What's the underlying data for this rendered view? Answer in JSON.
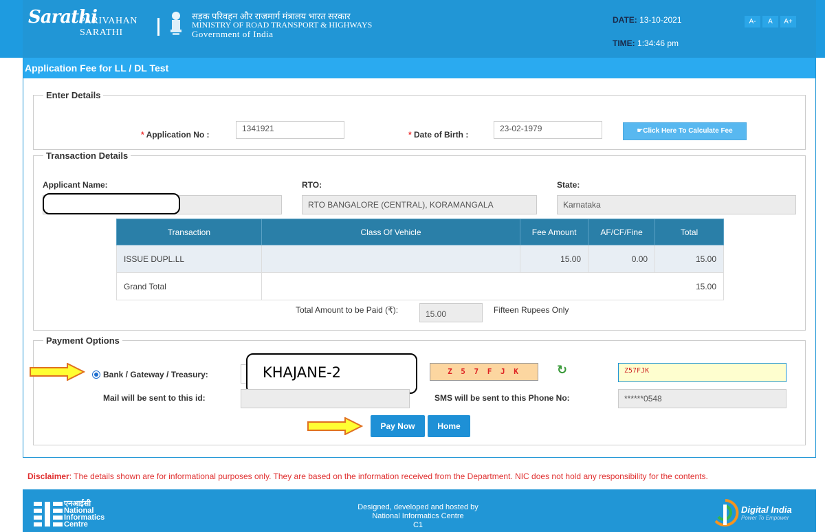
{
  "header": {
    "logo_sarathi": "Sarathi",
    "logo_parivahan": "PARIVAHAN",
    "logo_sarathi_en": "SARATHI",
    "ministry_hindi": "सड़क परिवहन और राजमार्ग मंत्रालय भारत सरकार",
    "ministry_en": "MINISTRY OF ROAD TRANSPORT & HIGHWAYS",
    "gov": "Government of India",
    "date_label": "DATE:",
    "date_value": "13-10-2021",
    "time_label": "TIME:",
    "time_value": "1:34:46 pm",
    "font_small": "A-",
    "font_normal": "A",
    "font_large": "A+"
  },
  "panel": {
    "title": "Application Fee for LL / DL Test"
  },
  "enter_details": {
    "legend": "Enter Details",
    "app_no_label": "Application No :",
    "app_no_value": "1341921",
    "dob_label": "Date of Birth :",
    "dob_value": "23-02-1979",
    "calc_button": "☛Click Here To Calculate Fee",
    "required_mark": "*"
  },
  "transaction_details": {
    "legend": "Transaction Details",
    "applicant_label": "Applicant Name:",
    "applicant_value": "",
    "rto_label": "RTO:",
    "rto_value": "RTO BANGALORE (CENTRAL), KORAMANGALA",
    "state_label": "State:",
    "state_value": "Karnataka",
    "table": {
      "headers": [
        "Transaction",
        "Class Of Vehicle",
        "Fee Amount",
        "AF/CF/Fine",
        "Total"
      ],
      "rows": [
        {
          "transaction": "ISSUE DUPL.LL",
          "class": "",
          "fee": "15.00",
          "af": "0.00",
          "total": "15.00"
        }
      ],
      "grand_total_label": "Grand Total",
      "grand_total_value": "15.00"
    },
    "total_label": "Total Amount to be Paid (₹):",
    "total_value": "15.00",
    "total_words": "Fifteen Rupees Only"
  },
  "payment": {
    "legend": "Payment Options",
    "bank_label": "Bank / Gateway / Treasury:",
    "bank_value": "KHAJANE-2",
    "captcha": "Z 5 7 F J K",
    "captcha_input": "Z57FJK",
    "mail_label": "Mail will be sent to this id:",
    "mail_value": "",
    "sms_label": "SMS will be sent to this Phone No:",
    "sms_value": "******0548",
    "pay_now": "Pay Now",
    "home": "Home"
  },
  "disclaimer": {
    "label": "Disclaimer",
    "text": ": The details shown are for informational purposes only. They are based on the information received from the Department. NIC does not hold any responsibility for the contents."
  },
  "footer": {
    "nic_hindi": "एनआईसी",
    "nic_line1": "National",
    "nic_line2": "Informatics",
    "nic_line3": "Centre",
    "designed_1": "Designed, developed and hosted by",
    "designed_2": "National Informatics Centre",
    "designed_3": "C1",
    "digital_india": "Digital India",
    "digital_india_sub": "Power To Empower"
  },
  "colors": {
    "header_blue": "#2196d6",
    "title_blue": "#2aaaf0",
    "table_header": "#2a7fa8",
    "button_blue": "#1e90d6",
    "disclaimer_red": "#e03030"
  }
}
